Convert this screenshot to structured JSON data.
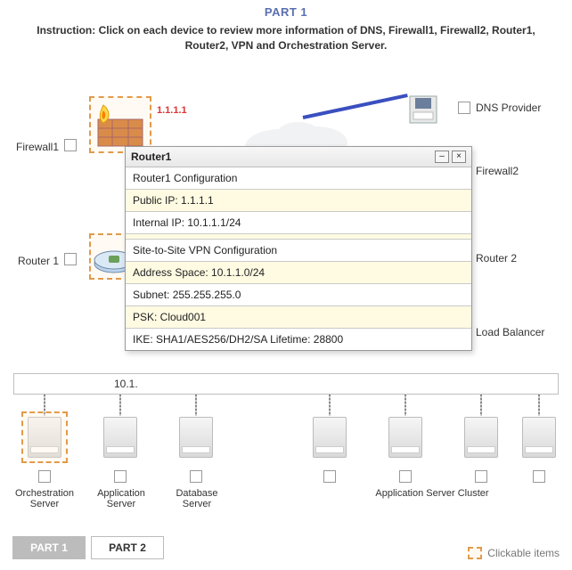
{
  "header": {
    "part_label": "PART 1"
  },
  "instruction": "Instruction: Click on each device to review more information of DNS, Firewall1, Firewall2, Router1, Router2, VPN and Orchestration Server.",
  "labels": {
    "dns_provider": "DNS Provider",
    "firewall1": "Firewall1",
    "firewall2": "Firewall2",
    "router1": "Router 1",
    "router2": "Router 2",
    "load_balancer": "Load Balancer"
  },
  "firewall1_ip": "1.1.1.1",
  "subnets": {
    "left_visible": "10.1."
  },
  "servers": {
    "orchestration": "Orchestration Server",
    "application": "Application Server",
    "database": "Database Server",
    "app_cluster": "Application Server Cluster"
  },
  "dialog": {
    "title": "Router1",
    "rows": [
      "Router1 Configuration",
      "Public IP: 1.1.1.1",
      "Internal IP: 10.1.1.1/24",
      "Site-to-Site VPN Configuration",
      "Address Space: 10.1.1.0/24",
      "Subnet: 255.255.255.0",
      "PSK: Cloud001",
      "IKE: SHA1/AES256/DH2/SA Lifetime: 28800"
    ]
  },
  "footer": {
    "part1": "PART 1",
    "part2": "PART 2",
    "legend": "Clickable items"
  }
}
